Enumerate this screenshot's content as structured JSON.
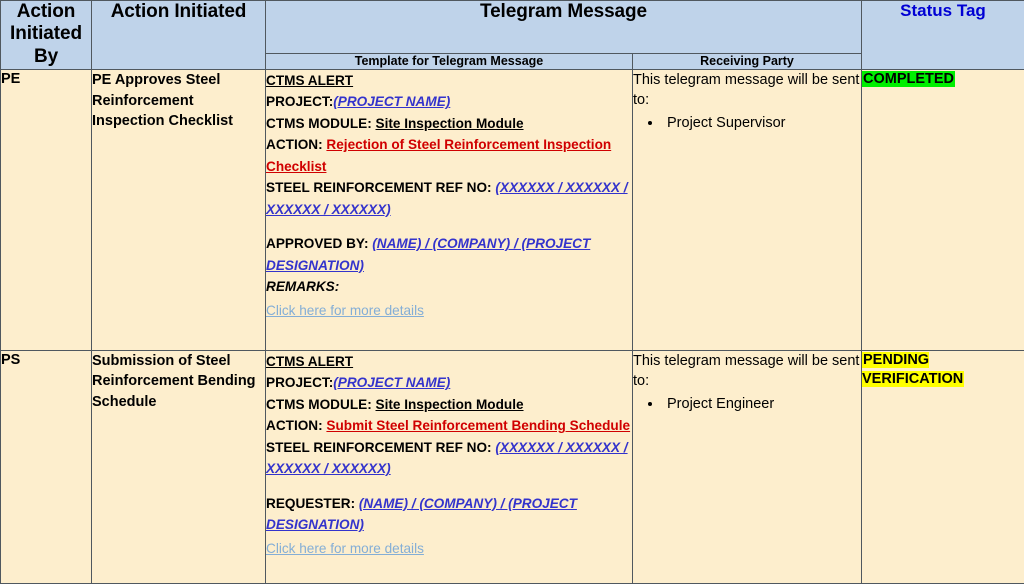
{
  "table": {
    "headers": {
      "action_initiated_by": "Action Initiated By",
      "action_initiated": "Action Initiated",
      "telegram_message": "Telegram Message",
      "template_for_telegram_message": "Template for Telegram Message",
      "receiving_party": "Receiving Party",
      "status_tag": "Status Tag"
    },
    "colors": {
      "header_background": "#bfd3ea",
      "cell_background": "#fdeecd",
      "border": "#50585f",
      "status_tag_header_text": "#0000d4",
      "placeholder_text": "#3333cc",
      "action_text": "#d00000",
      "link_text": "#84aed6",
      "completed_highlight": "#00ef00",
      "pending_highlight": "#ffff00"
    },
    "rows": [
      {
        "initiated_by": "PE",
        "action_initiated": "PE Approves Steel Reinforcement Inspection Checklist",
        "template": {
          "alert_title": "CTMS ALERT",
          "project_label": "PROJECT:",
          "project_value": "(PROJECT NAME)",
          "module_label": "CTMS MODULE:",
          "module_value": "Site Inspection Module",
          "action_label": "ACTION:",
          "action_value": "Rejection of Steel Reinforcement Inspection Checklist",
          "ref_label": "STEEL REINFORCEMENT REF NO:",
          "ref_value": "(XXXXXX / XXXXXX / XXXXXX / XXXXXX)",
          "person_label": "APPROVED BY:",
          "person_value": "(NAME) / (COMPANY) / (PROJECT DESIGNATION)",
          "remarks_label": "REMARKS:",
          "link_text": "Click here for more details"
        },
        "receiving": {
          "intro": "This telegram message will be sent to:",
          "parties": [
            "Project Supervisor"
          ]
        },
        "status_tag": "COMPLETED",
        "status_style": "completed"
      },
      {
        "initiated_by": "PS",
        "action_initiated": "Submission of Steel Reinforcement Bending Schedule",
        "template": {
          "alert_title": "CTMS ALERT",
          "project_label": "PROJECT:",
          "project_value": "(PROJECT NAME)",
          "module_label": "CTMS MODULE:",
          "module_value": "Site Inspection Module",
          "action_label": "ACTION:",
          "action_value": "Submit Steel Reinforcement Bending Schedule",
          "ref_label": "STEEL REINFORCEMENT REF NO:",
          "ref_value": "(XXXXXX / XXXXXX / XXXXXX / XXXXXX)",
          "person_label": "REQUESTER:",
          "person_value": "(NAME) / (COMPANY) / (PROJECT DESIGNATION)",
          "remarks_label": "",
          "link_text": "Click here for more details"
        },
        "receiving": {
          "intro": "This telegram message will be sent to:",
          "parties": [
            "Project Engineer"
          ]
        },
        "status_tag": "PENDING VERIFICATION",
        "status_style": "pending"
      }
    ]
  }
}
